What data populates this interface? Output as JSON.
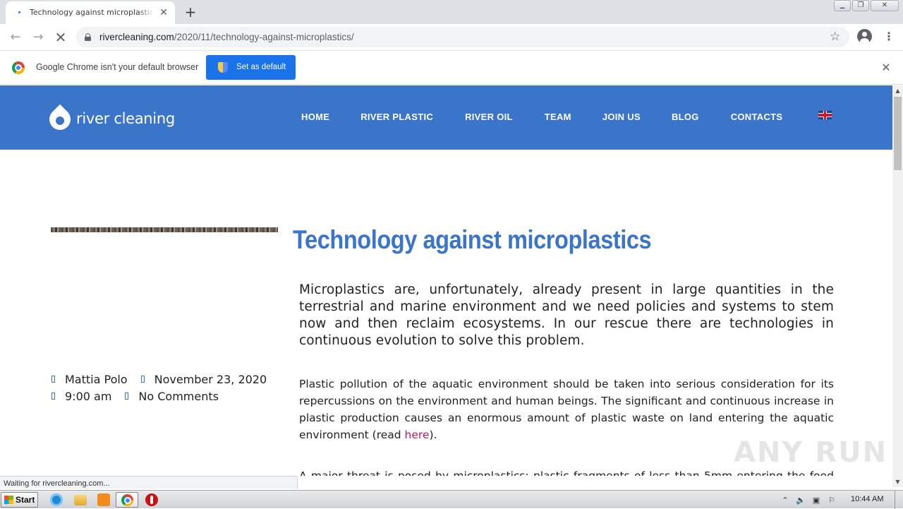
{
  "browser": {
    "tab_title": "Technology against microplastics - R",
    "tab_close": "✕",
    "new_tab": "+",
    "back": "←",
    "forward": "→",
    "reload_stop": "✕",
    "url_domain": "rivercleaning.com",
    "url_path": "/2020/11/technology-against-microplastics/",
    "bookmark": "☆",
    "menu": "⋮"
  },
  "infobar": {
    "message": "Google Chrome isn't your default browser",
    "button_label": "Set as default",
    "close": "✕"
  },
  "site": {
    "logo_text": "river cleaning",
    "nav": [
      "HOME",
      "RIVER PLASTIC",
      "RIVER OIL",
      "TEAM",
      "JOIN US",
      "BLOG",
      "CONTACTS"
    ]
  },
  "post": {
    "title": "Technology against microplastics",
    "author": "Mattia Polo",
    "date": "November 23, 2020",
    "time": "9:00 am",
    "comments": "No Comments",
    "lead": "Microplastics are, unfortunately, already present in large quantities in the terrestrial and marine environment and we need policies and systems to stem now and then reclaim ecosystems. In our rescue there are technologies in continuous evolution to solve this problem.",
    "para1_before": "Plastic pollution of the aquatic environment should be taken into serious consideration for its repercussions on the environment and human beings. The significant and continuous increase in plastic production causes an enormous amount of plastic waste on land entering the aquatic environment (read ",
    "para1_link": "here",
    "para1_after": ").",
    "para2": "A major threat is posed by microplastics: plastic fragments of less than 5mm entering the food chain"
  },
  "watermark": "ANY RUN",
  "status_text": "Waiting for rivercleaning.com...",
  "taskbar": {
    "start_label": "Start",
    "clock": "10:44 AM"
  },
  "colors": {
    "site_blue": "#3a75c9",
    "link_pink": "#c2185b",
    "chrome_button_blue": "#1a73e8"
  }
}
